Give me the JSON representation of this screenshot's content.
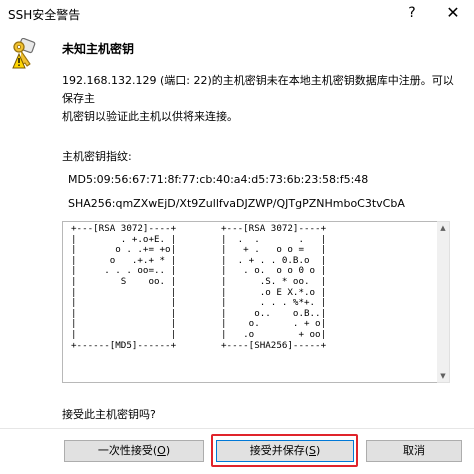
{
  "window": {
    "title": "SSH安全警告",
    "help_label": "?",
    "close_label": "✕"
  },
  "header": {
    "icon": "key-icon",
    "title": "未知主机密钥"
  },
  "description": {
    "line1": "192.168.132.129 (端口: 22)的主机密钥未在本地主机密钥数据库中注册。可以保存主",
    "line2": "机密钥以验证此主机以供将来连接。"
  },
  "fingerprint": {
    "label": "主机密钥指纹:",
    "md5": "MD5:09:56:67:71:8f:77:cb:40:a4:d5:73:6b:23:58:f5:48",
    "sha256": "SHA256:qmZXwEjD/Xt9ZullfvaDJZWP/QJTgPZNHmboC3tvCbA"
  },
  "randomart": {
    "md5": "+---[RSA 3072]----+\n|        . +.o+E. |\n|       o . .+= +o|\n|      o   .+.+ * |\n|     . . . oo=.. |\n|        S    oo. |\n|                 |\n|                 |\n|                 |\n|                 |\n|                 |\n+------[MD5]------+",
    "sha256": "+---[RSA 3072]----+\n|  .  .       .   |\n|   + .   o o =   |\n|  . + . . 0.B.o  |\n|   . o.  o o 0 o |\n|      .S. * oo.  |\n|      .o E X.*.o |\n|      . . . %*+. |\n|     o..    o.B..|\n|    o.      . + o|\n|   .o        + oo|\n+----[SHA256]-----+"
  },
  "question": "接受此主机密钥吗?",
  "buttons": {
    "accept_once": {
      "label": "一次性接受",
      "mnemonic": "O"
    },
    "accept_save": {
      "label": "接受并保存",
      "mnemonic": "S"
    },
    "cancel": {
      "label": "取消"
    }
  },
  "colors": {
    "highlight_outline": "#e0242b",
    "default_button_border": "#0078d7"
  }
}
